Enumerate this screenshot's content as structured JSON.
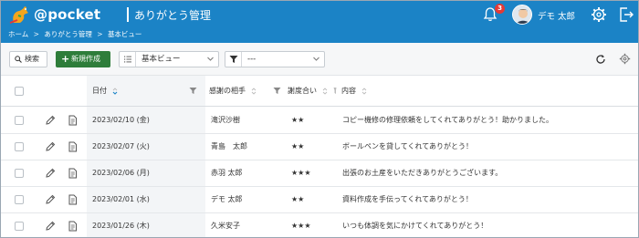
{
  "app": {
    "logo_text": "@pocket",
    "page_heading": "ありがとう管理"
  },
  "header": {
    "notification_count": "3",
    "user_name": "デモ 太郎"
  },
  "breadcrumb": {
    "items": [
      "ホーム",
      "ありがとう管理",
      "基本ビュー"
    ],
    "separator": ">"
  },
  "toolbar": {
    "search_label": "検索",
    "new_label": "新規作成",
    "view_value": "基本ビュー",
    "filter_value": "---"
  },
  "table": {
    "headers": {
      "date": "日付",
      "partner": "感謝の相手",
      "level": "謝度合い",
      "content": "内容"
    },
    "rows": [
      {
        "date": "2023/02/10 (金)",
        "partner": "滝沢沙樹",
        "level": "★★",
        "content": "コピー機修の修理依頼をしてくれてありがとう！助かりました。"
      },
      {
        "date": "2023/02/07 (火)",
        "partner": "青島　太郎",
        "level": "★★",
        "content": "ボールペンを貸してくれてありがとう！"
      },
      {
        "date": "2023/02/06 (月)",
        "partner": "赤羽 太郎",
        "level": "★★★",
        "content": "出張のお土産をいただきありがとうございます。"
      },
      {
        "date": "2023/02/01 (水)",
        "partner": "デモ 太郎",
        "level": "★★",
        "content": "資料作成を手伝ってくれてありがとう！"
      },
      {
        "date": "2023/01/26 (木)",
        "partner": "久米安子",
        "level": "★★★",
        "content": "いつも体調を気にかけてくれてありがとう！"
      }
    ]
  },
  "colors": {
    "brand": "#1b83c6",
    "primary_button": "#2e7d3a",
    "badge": "#e53935"
  }
}
